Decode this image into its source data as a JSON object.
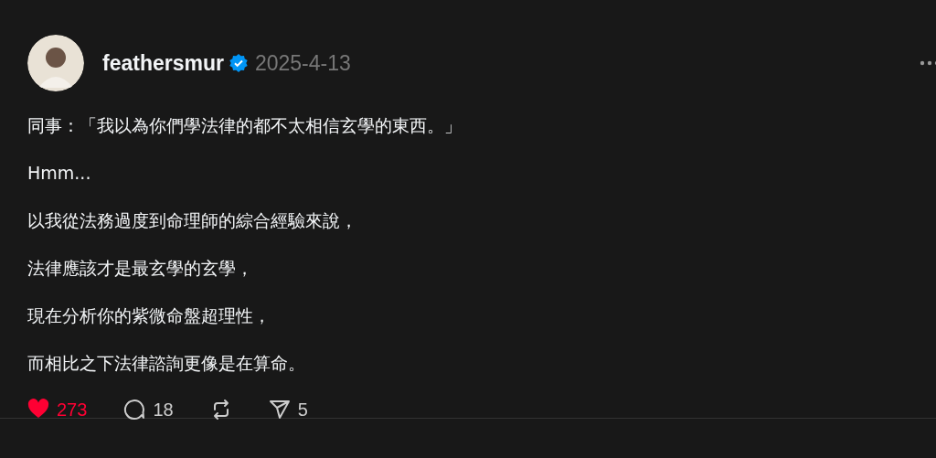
{
  "post": {
    "author": "feathersmur",
    "verified": true,
    "date": "2025-4-13",
    "paragraphs": [
      "同事：「我以為你們學法律的都不太相信玄學的東西。」",
      "Hmm...",
      "以我從法務過度到命理師的綜合經驗來說，",
      "法律應該才是最玄學的玄學，",
      "現在分析你的紫微命盤超理性，",
      "而相比之下法律諮詢更像是在算命。"
    ],
    "actions": [
      {
        "kind": "like",
        "count": "273",
        "selected": true
      },
      {
        "kind": "comment",
        "count": "18"
      },
      {
        "kind": "repost"
      },
      {
        "kind": "share",
        "count": "5"
      }
    ]
  }
}
